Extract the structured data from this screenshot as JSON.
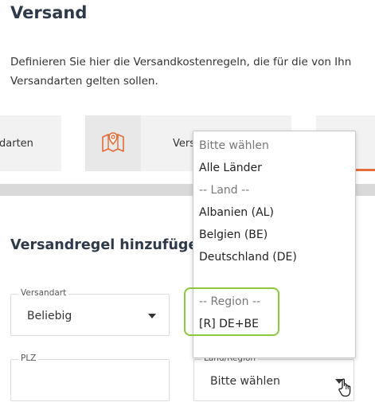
{
  "page": {
    "title": "Versand",
    "intro_line1": "Definieren Sie hier die Versandkostenregeln, die für die von Ihn",
    "intro_line2": "Versandarten gelten sollen."
  },
  "tabs": [
    {
      "label": "darten"
    },
    {
      "icon": "map-icon"
    },
    {
      "label": "Vers"
    },
    {
      "label": ""
    }
  ],
  "colors": {
    "accent": "#e36d3a",
    "highlight": "#8dc63f"
  },
  "form": {
    "title": "Versandregel hinzufügen",
    "versandart": {
      "label": "Versandart",
      "value": "Beliebig"
    },
    "plz": {
      "label": "PLZ",
      "value": ""
    },
    "land_region": {
      "label": "Land/Region",
      "value": "Bitte wählen"
    }
  },
  "dropdown": {
    "options": [
      {
        "label": "Bitte wählen",
        "muted": true
      },
      {
        "label": "Alle Länder",
        "muted": false
      },
      {
        "label": "-- Land --",
        "muted": true
      },
      {
        "label": "Albanien (AL)",
        "muted": false
      },
      {
        "label": "Belgien (BE)",
        "muted": false
      },
      {
        "label": "Deutschland (DE)",
        "muted": false
      },
      {
        "label": "",
        "muted": false
      },
      {
        "label": "-- Region --",
        "muted": true
      },
      {
        "label": "[R] DE+BE",
        "muted": false
      }
    ]
  }
}
